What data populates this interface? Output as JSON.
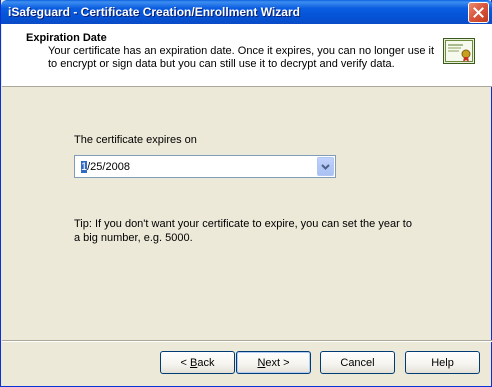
{
  "window": {
    "title": "iSafeguard - Certificate Creation/Enrollment Wizard",
    "close_icon": "close-icon",
    "accent": "#0553D6"
  },
  "header": {
    "title": "Expiration Date",
    "description": "Your certificate has an expiration date. Once it expires, you can no longer use it to encrypt or sign data but you can still use it to decrypt and verify data.",
    "icon": "certificate-icon"
  },
  "content": {
    "expires_label": "The certificate expires on",
    "date_field": {
      "selected_part": "1",
      "rest": "/25/2008",
      "dropdown_icon": "chevron-down-icon"
    },
    "tip": "Tip: If you don't want your certificate to expire, you can set the year to a big number, e.g. 5000."
  },
  "buttons": {
    "back_prefix": "< ",
    "back_key": "B",
    "back_rest": "ack",
    "next_key": "N",
    "next_rest": "ext >",
    "cancel": "Cancel",
    "help": "Help"
  }
}
